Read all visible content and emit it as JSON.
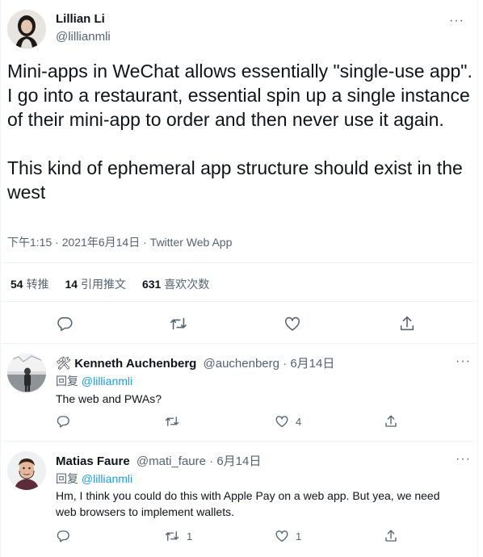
{
  "tweet": {
    "author_name": "Lillian Li",
    "author_handle": "@lillianmli",
    "more_label": "···",
    "text": "Mini-apps in WeChat allows essentially \"single-use app\". I go into a restaurant, essential spin up a single instance of their mini-app to order and then never use it again.\n\nThis kind of ephemeral app structure should exist in the west",
    "time": "下午1:15",
    "date": "2021年6月14日",
    "source": "Twitter Web App",
    "separator": "·",
    "stats": {
      "retweets_count": "54",
      "retweets_label": "转推",
      "quotes_count": "14",
      "quotes_label": "引用推文",
      "likes_count": "631",
      "likes_label": "喜欢次数"
    }
  },
  "replies": [
    {
      "emoji": "🛠",
      "author_name": "Kenneth Auchenberg",
      "author_handle": "@auchenberg",
      "separator": "·",
      "date": "6月14日",
      "reply_prefix": "回复",
      "reply_to": "@lillianmli",
      "text": "The web and PWAs?",
      "replies_count": "",
      "retweets_count": "",
      "likes_count": "4"
    },
    {
      "emoji": "",
      "author_name": "Matias Faure",
      "author_handle": "@mati_faure",
      "separator": "·",
      "date": "6月14日",
      "reply_prefix": "回复",
      "reply_to": "@lillianmli",
      "text": "Hm, I think you could do this with Apple Pay on a web app. But yea, we need web browsers to implement wallets.",
      "replies_count": "",
      "retweets_count": "1",
      "likes_count": "1"
    }
  ],
  "more_label": "···",
  "colors": {
    "text": "#0f1419",
    "secondary": "#536471",
    "link": "#1d9bf0",
    "border": "#eff3f4"
  },
  "icons": [
    "reply-icon",
    "retweet-icon",
    "like-icon",
    "share-icon",
    "more-icon",
    "hammer-and-wrench-icon"
  ]
}
